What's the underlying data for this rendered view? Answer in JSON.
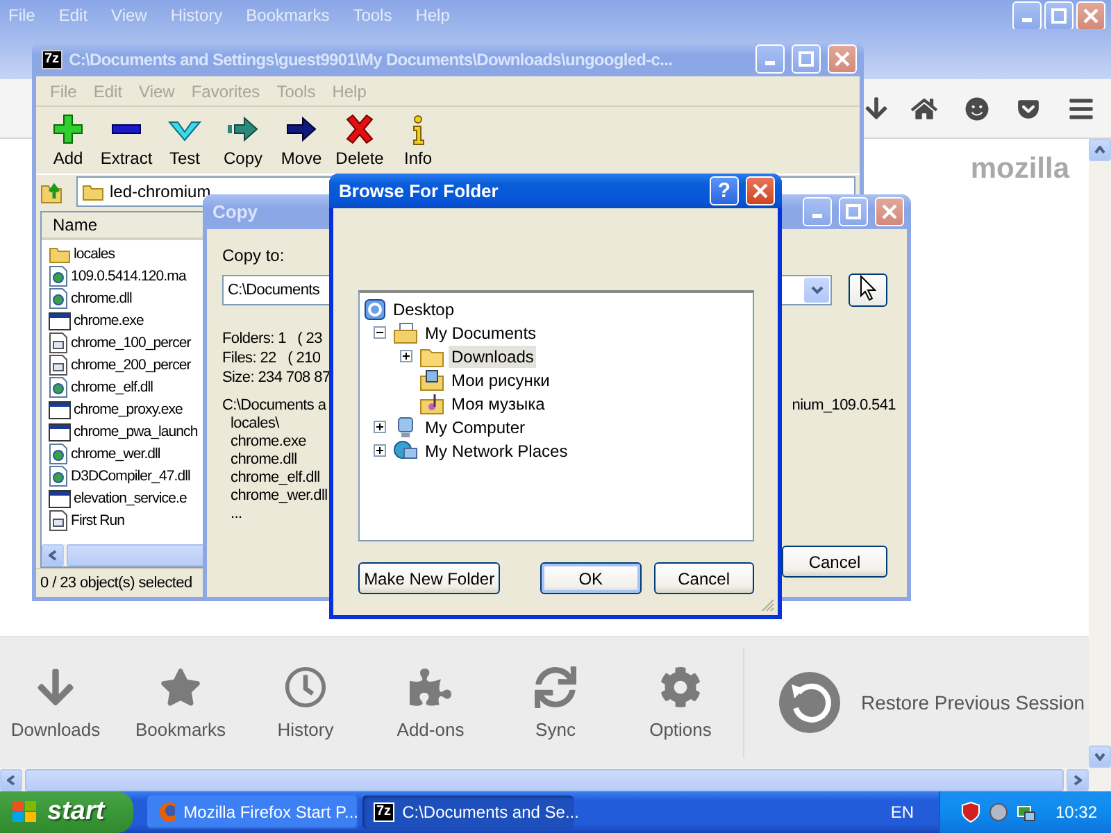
{
  "firefox": {
    "menu": [
      "File",
      "Edit",
      "View",
      "History",
      "Bookmarks",
      "Tools",
      "Help"
    ],
    "brand": "mozilla",
    "launcher": [
      {
        "label": "Downloads",
        "kind": "downloads"
      },
      {
        "label": "Bookmarks",
        "kind": "bookmarks"
      },
      {
        "label": "History",
        "kind": "history"
      },
      {
        "label": "Add-ons",
        "kind": "addons"
      },
      {
        "label": "Sync",
        "kind": "sync"
      },
      {
        "label": "Options",
        "kind": "options"
      }
    ],
    "restore_session": "Restore Previous Session"
  },
  "archive_window": {
    "logo": "7z",
    "title": "C:\\Documents and Settings\\guest9901\\My Documents\\Downloads\\ungoogled-c...",
    "menu": [
      "File",
      "Edit",
      "View",
      "Favorites",
      "Tools",
      "Help"
    ],
    "toolbar": [
      {
        "label": "Add",
        "kind": "add"
      },
      {
        "label": "Extract",
        "kind": "extract"
      },
      {
        "label": "Test",
        "kind": "test"
      },
      {
        "label": "Copy",
        "kind": "copy"
      },
      {
        "label": "Move",
        "kind": "move"
      },
      {
        "label": "Delete",
        "kind": "delete"
      },
      {
        "label": "Info",
        "kind": "info"
      }
    ],
    "path": "led-chromium",
    "column": "Name",
    "files": [
      {
        "name": "locales",
        "kind": "folder"
      },
      {
        "name": "109.0.5414.120.ma",
        "kind": "dll"
      },
      {
        "name": "chrome.dll",
        "kind": "dll"
      },
      {
        "name": "chrome.exe",
        "kind": "exe"
      },
      {
        "name": "chrome_100_percer",
        "kind": "pak"
      },
      {
        "name": "chrome_200_percer",
        "kind": "pak"
      },
      {
        "name": "chrome_elf.dll",
        "kind": "dll"
      },
      {
        "name": "chrome_proxy.exe",
        "kind": "exe"
      },
      {
        "name": "chrome_pwa_launch",
        "kind": "exe"
      },
      {
        "name": "chrome_wer.dll",
        "kind": "dll"
      },
      {
        "name": "D3DCompiler_47.dll",
        "kind": "dll"
      },
      {
        "name": "elevation_service.e",
        "kind": "exe"
      },
      {
        "name": "First Run",
        "kind": "pak"
      }
    ],
    "status": "0 / 23 object(s) selected"
  },
  "copy_dialog": {
    "title": "Copy",
    "label": "Copy to:",
    "destination": "C:\\Documents",
    "info": [
      "Folders: 1   ( 23",
      "Files: 22   ( 210",
      "Size: 234 708 87"
    ],
    "source_left": "C:\\Documents a",
    "source_right": "nium_109.0.541",
    "items": [
      "locales\\",
      "chrome.exe",
      "chrome.dll",
      "chrome_elf.dll",
      "chrome_wer.dll",
      "..."
    ],
    "cancel": "Cancel"
  },
  "browse_dialog": {
    "title": "Browse For Folder",
    "help": "?",
    "tree": [
      {
        "label": "Desktop",
        "kind": "desktop",
        "expandable": false,
        "selected": false,
        "children": [
          {
            "label": "My Documents",
            "kind": "documents",
            "expandable": true,
            "expanded": true,
            "selected": false,
            "children": [
              {
                "label": "Downloads",
                "kind": "folder",
                "expandable": true,
                "expanded": false,
                "selected": true
              },
              {
                "label": "Мои рисунки",
                "kind": "pictures",
                "expandable": false,
                "selected": false
              },
              {
                "label": "Моя музыка",
                "kind": "music",
                "expandable": false,
                "selected": false
              }
            ]
          },
          {
            "label": "My Computer",
            "kind": "computer",
            "expandable": true,
            "expanded": false,
            "selected": false
          },
          {
            "label": "My Network Places",
            "kind": "network",
            "expandable": true,
            "expanded": false,
            "selected": false
          }
        ]
      }
    ],
    "buttons": [
      {
        "label": "Make New Folder",
        "default": false
      },
      {
        "label": "OK",
        "default": true
      },
      {
        "label": "Cancel",
        "default": false
      }
    ]
  },
  "taskbar": {
    "start": "start",
    "tasks": [
      {
        "label": "Mozilla Firefox Start P...",
        "kind": "firefox",
        "selected": false
      },
      {
        "label": "C:\\Documents and Se...",
        "kind": "archive",
        "icon_text": "7z",
        "selected": true
      }
    ],
    "language": "EN",
    "clock": "10:32"
  }
}
